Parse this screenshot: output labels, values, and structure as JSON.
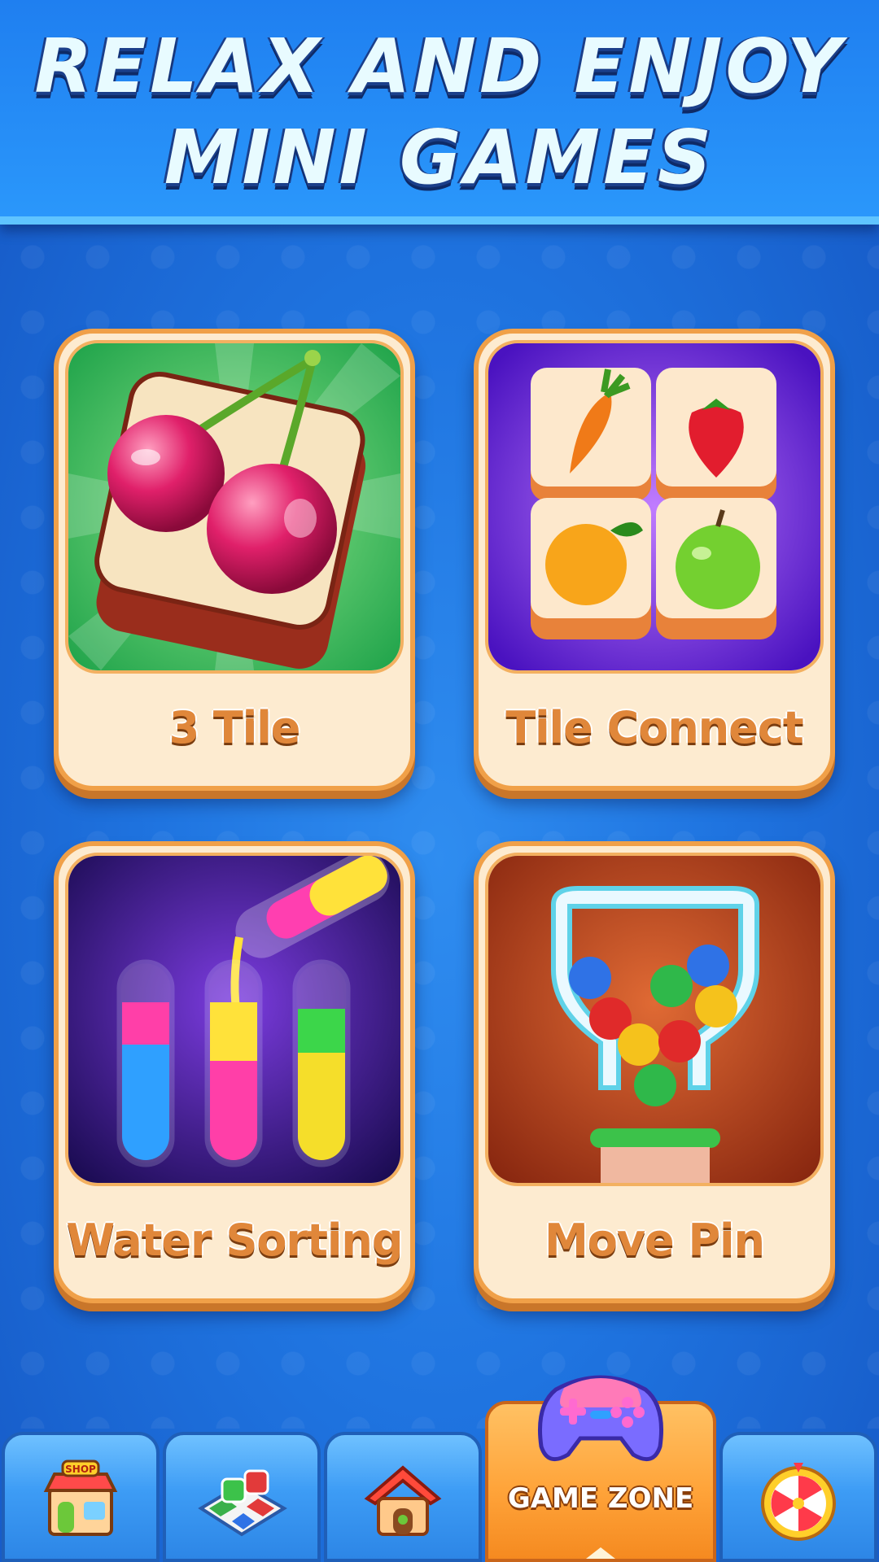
{
  "header": {
    "title_line1": "RELAX AND ENJOY",
    "title_line2": "MINI GAMES"
  },
  "games": [
    {
      "label": "3 Tile",
      "icon": "cherry-tile-icon"
    },
    {
      "label": "Tile Connect",
      "icon": "fruit-tiles-icon"
    },
    {
      "label": "Water Sorting",
      "icon": "test-tubes-icon"
    },
    {
      "label": "Move Pin",
      "icon": "pin-balls-icon"
    }
  ],
  "nav": {
    "tabs": [
      {
        "id": "shop",
        "icon": "shop-icon",
        "sign": "SHOP"
      },
      {
        "id": "board",
        "icon": "ludo-dice-icon"
      },
      {
        "id": "home",
        "icon": "house-icon"
      },
      {
        "id": "game-zone",
        "icon": "gamepad-icon",
        "label": "GAME ZONE",
        "active": true
      },
      {
        "id": "wheel",
        "icon": "lucky-wheel-icon"
      }
    ]
  },
  "colors": {
    "accent": "#ffa43a",
    "card": "#fdebd0",
    "background": "#1f74e0"
  }
}
